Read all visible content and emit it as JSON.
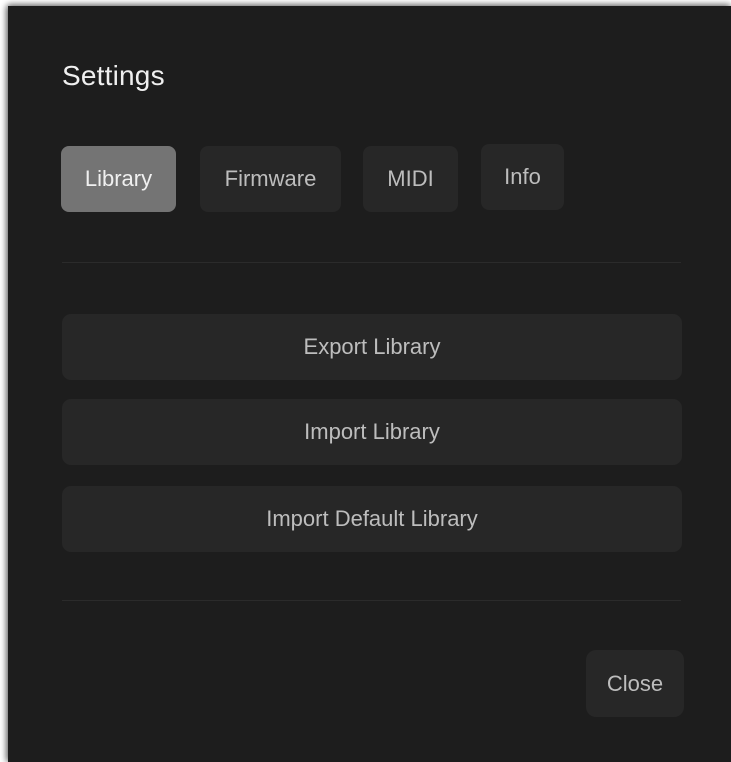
{
  "dialog": {
    "title": "Settings"
  },
  "tabs": [
    {
      "label": "Library",
      "active": true
    },
    {
      "label": "Firmware",
      "active": false
    },
    {
      "label": "MIDI",
      "active": false
    },
    {
      "label": "Info",
      "active": false
    }
  ],
  "library_actions": {
    "export_label": "Export Library",
    "import_label": "Import Library",
    "import_default_label": "Import Default Library"
  },
  "footer": {
    "close_label": "Close"
  },
  "colors": {
    "background": "#1d1d1d",
    "button": "#272727",
    "active_tab": "#747474",
    "text": "#bdbdbd",
    "title_text": "#efefef"
  }
}
